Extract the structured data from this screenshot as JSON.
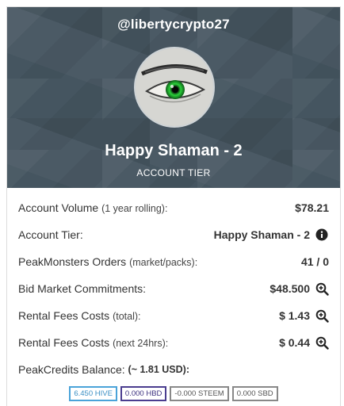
{
  "header": {
    "username": "@libertycrypto27",
    "tier_name": "Happy Shaman - 2",
    "tier_subtitle": "ACCOUNT TIER",
    "avatar_icon": "eye-avatar"
  },
  "rows": [
    {
      "label": "Account Volume",
      "note": "(1 year rolling):",
      "value": "$78.21",
      "icon": null
    },
    {
      "label": "Account Tier:",
      "note": "",
      "value": "Happy Shaman - 2",
      "icon": "info-icon"
    },
    {
      "label": "PeakMonsters Orders",
      "note": "(market/packs):",
      "value": "41 / 0",
      "icon": null
    },
    {
      "label": "Bid Market Commitments:",
      "note": "",
      "value": "$48.500",
      "icon": "zoom-icon"
    },
    {
      "label": "Rental Fees Costs",
      "note": "(total):",
      "value": "$ 1.43",
      "icon": "zoom-icon"
    },
    {
      "label": "Rental Fees Costs",
      "note": "(next 24hrs):",
      "value": "$ 0.44",
      "icon": "zoom-icon"
    }
  ],
  "credits": {
    "label": "PeakCredits Balance:",
    "usd": "(~ 1.81 USD):",
    "badges": {
      "hive": "6.450 HIVE",
      "hbd": "0.000 HBD",
      "steem": "-0.000 STEEM",
      "sbd": "0.000 SBD"
    }
  },
  "colors": {
    "header_bg": "#455560",
    "hive": "#4aa3d9",
    "hbd": "#4a3d8f",
    "neutral": "#888888"
  }
}
